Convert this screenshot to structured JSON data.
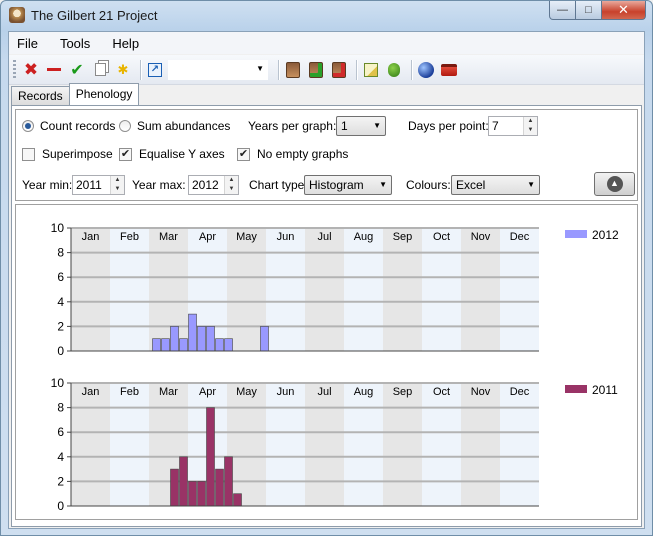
{
  "window": {
    "title": "The Gilbert 21 Project"
  },
  "menu": [
    "File",
    "Tools",
    "Help"
  ],
  "toolbar": {
    "icons": [
      "delete-icon",
      "remove-icon",
      "accept-icon",
      "copy-icon",
      "star-icon",
      "shortcut-icon",
      "combo",
      "person-icon",
      "person-add-icon",
      "person-remove-icon",
      "edit-icon",
      "bug-icon",
      "globe-icon",
      "toolbox-icon"
    ],
    "combo_value": "",
    "colors": {
      "delete": "#cc2020",
      "remove": "#cc2020",
      "accept": "#1a9a1a",
      "star": "#e8b400",
      "shortcut": "#1a5fb4"
    }
  },
  "tabs": [
    {
      "label": "Records",
      "active": false
    },
    {
      "label": "Phenology",
      "active": true
    }
  ],
  "controls": {
    "count_records": {
      "label": "Count records",
      "selected": true
    },
    "sum_abundances": {
      "label": "Sum abundances",
      "selected": false
    },
    "years_per_graph": {
      "label": "Years per graph:",
      "value": "1"
    },
    "days_per_point": {
      "label": "Days per point:",
      "value": "7"
    },
    "superimpose": {
      "label": "Superimpose",
      "checked": false
    },
    "equalise_y": {
      "label": "Equalise Y axes",
      "checked": true
    },
    "no_empty_graphs": {
      "label": "No empty graphs",
      "checked": true
    },
    "year_min": {
      "label": "Year min:",
      "value": "2011"
    },
    "year_max": {
      "label": "Year max:",
      "value": "2012"
    },
    "chart_type": {
      "label": "Chart type:",
      "value": "Histogram"
    },
    "colours": {
      "label": "Colours:",
      "value": "Excel"
    }
  },
  "chart_data": [
    {
      "type": "bar",
      "months": [
        "Jan",
        "Feb",
        "Mar",
        "Apr",
        "May",
        "Jun",
        "Jul",
        "Aug",
        "Sep",
        "Oct",
        "Nov",
        "Dec"
      ],
      "yticks": [
        0,
        2,
        4,
        6,
        8,
        10
      ],
      "ylim": [
        0,
        10
      ],
      "x_unit": "week",
      "x_range": [
        1,
        52
      ],
      "series": [
        {
          "name": "2012",
          "color": "#9999ff",
          "weeks": [
            10,
            11,
            12,
            13,
            14,
            15,
            16,
            17,
            18,
            19,
            20,
            21,
            22
          ],
          "values": [
            1,
            1,
            2,
            1,
            3,
            2,
            2,
            1,
            1,
            0,
            0,
            0,
            2
          ]
        }
      ],
      "legend_position": "top-right",
      "grid": true
    },
    {
      "type": "bar",
      "months": [
        "Jan",
        "Feb",
        "Mar",
        "Apr",
        "May",
        "Jun",
        "Jul",
        "Aug",
        "Sep",
        "Oct",
        "Nov",
        "Dec"
      ],
      "yticks": [
        0,
        2,
        4,
        6,
        8,
        10
      ],
      "ylim": [
        0,
        10
      ],
      "x_unit": "week",
      "x_range": [
        1,
        52
      ],
      "series": [
        {
          "name": "2011",
          "color": "#993366",
          "weeks": [
            12,
            13,
            14,
            15,
            16,
            17,
            18,
            19
          ],
          "values": [
            3,
            4,
            2,
            2,
            8,
            3,
            4,
            1
          ]
        }
      ],
      "legend_position": "top-right",
      "grid": true
    }
  ]
}
